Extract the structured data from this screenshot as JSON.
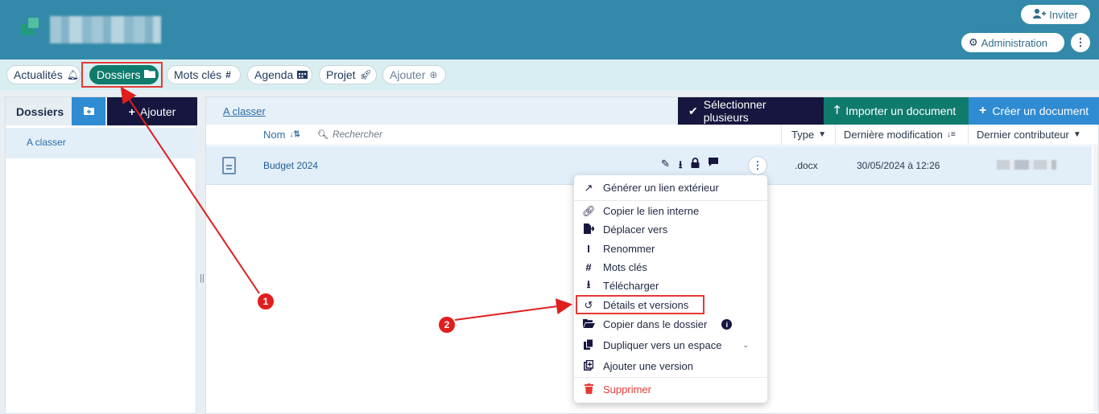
{
  "header": {
    "inviter_label": "Inviter",
    "admin_label": "Administration",
    "menu_icon": "kebab-vertical-icon"
  },
  "nav": {
    "tabs": [
      {
        "label": "Actualités",
        "icon": "bell-icon"
      },
      {
        "label": "Dossiers",
        "icon": "folder-icon",
        "active": true
      },
      {
        "label": "Mots clés",
        "icon": "hashtag-icon"
      },
      {
        "label": "Agenda",
        "icon": "calendar-icon"
      },
      {
        "label": "Projet",
        "icon": "rocket-icon"
      },
      {
        "label": "Ajouter",
        "icon": "plus-circle-icon"
      }
    ]
  },
  "left_panel": {
    "title": "Dossiers",
    "add_label": "Ajouter",
    "folders": [
      "A classer"
    ]
  },
  "main": {
    "breadcrumb": "A classer",
    "actions": {
      "select_multiple": "Sélectionner plusieurs",
      "import_document": "Importer un document",
      "create_document": "Créer un document"
    },
    "columns": {
      "name": "Nom",
      "search_placeholder": "Rechercher",
      "type": "Type",
      "last_modified": "Dernière modification",
      "last_contributor": "Dernier contributeur"
    },
    "rows": [
      {
        "name": "Budget 2024",
        "type": ".docx",
        "modified": "30/05/2024 à 12:26"
      }
    ]
  },
  "context_menu": {
    "items": [
      {
        "label": "Générer un lien extérieur",
        "icon": "external-link-icon"
      },
      {
        "label": "Copier le lien interne",
        "icon": "link-icon"
      },
      {
        "label": "Déplacer vers",
        "icon": "move-file-icon"
      },
      {
        "label": "Renommer",
        "icon": "text-cursor-icon"
      },
      {
        "label": "Mots clés",
        "icon": "hashtag-icon"
      },
      {
        "label": "Télécharger",
        "icon": "download-icon"
      },
      {
        "label": "Détails et versions",
        "icon": "history-icon"
      },
      {
        "label": "Copier dans le dossier",
        "icon": "folder-open-icon"
      },
      {
        "label": "Dupliquer vers un espace",
        "icon": "copy-icon"
      },
      {
        "label": "Ajouter une version",
        "icon": "add-version-icon"
      },
      {
        "label": "Supprimer",
        "icon": "trash-icon"
      }
    ]
  },
  "annotations": {
    "step1": "1",
    "step2": "2"
  },
  "colors": {
    "header": "#3389a9",
    "accent_green": "#0f7b6c",
    "accent_navy": "#17163f",
    "accent_blue": "#2f8bd2",
    "annotation_red": "#e53935"
  }
}
